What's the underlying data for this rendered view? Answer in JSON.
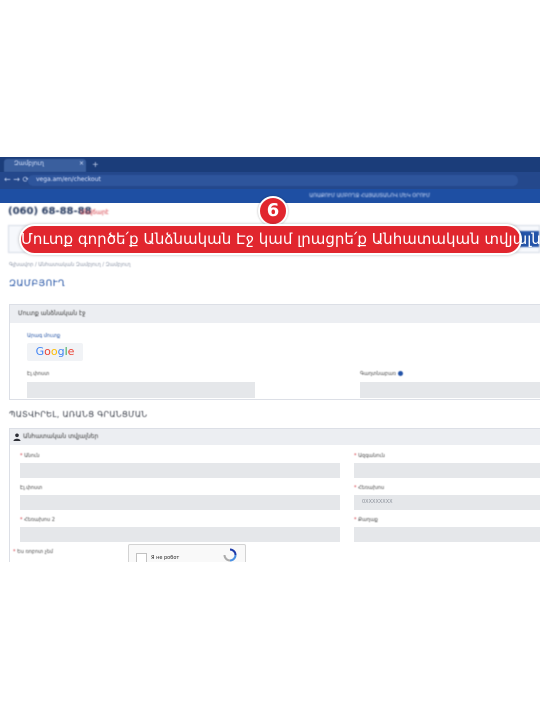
{
  "browser": {
    "tab_title": "Զամբյուղ",
    "tab_close": "×",
    "new_tab": "+",
    "nav_arrows": "← →  ⟳",
    "url": "vega.am/en/checkout"
  },
  "site": {
    "top_bar_text": "ԱՌԱՔՈՒՄ ԱՄԲՈՂՋ ՀԱՅԱՍՏԱՆՈՎ ՄԵԿ ՕՐՈՒՄ",
    "phone": "(060) 68-88-88",
    "phone_note": "Անվճարէ"
  },
  "overlay": {
    "step_number": "6",
    "instruction": "Մուտք գործե՛ք Անձնական Էջ կամ լրացրե՛ք Անհատական տվյալները",
    "accent_color": "#e1262e"
  },
  "breadcrumb": "Գլխավոր  /  Անհատական Զամբյուղ  /  Զամբյուղ",
  "page_title": "ԶԱՄԲՅՈՒՂ",
  "login": {
    "heading": "Մուտք անձնական էջ",
    "quick_login": "Արագ մուտք",
    "google_letters": [
      "G",
      "o",
      "o",
      "g",
      "l",
      "e"
    ],
    "email_label": "Էլ.փոստ",
    "password_label": "Գաղտնաբառ"
  },
  "checkout_heading": "ՊԱՏՎԻՐԵԼ, ԱՌԱՆՑ ԳՐԱՆՑՄԱՆ",
  "personal": {
    "heading": "Անհատական տվյալներ",
    "first_name": "Անուն",
    "last_name": "Ազգանուն",
    "email": "Էլ.փոստ",
    "phone": "Հեռախոս",
    "phone_placeholder": "0XXXXXXXX",
    "phone2": "Հեռախոս 2",
    "city": "Քաղաք",
    "required_mark": "*",
    "captcha_label": "Ես ռոբոտ չեմ",
    "captcha_text": "Я не робот"
  }
}
